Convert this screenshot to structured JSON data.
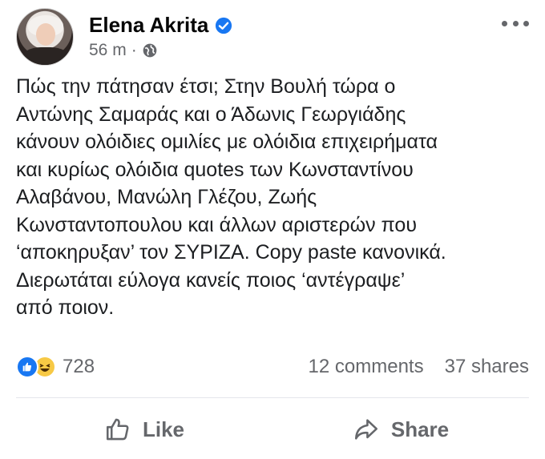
{
  "post": {
    "author": "Elena Akrita",
    "time": "56 m",
    "separator": "·",
    "privacy_icon": "globe-icon",
    "verified_icon": "verified-badge-icon",
    "more_icon": "more-options-icon",
    "text_lines": [
      "Πώς την πάτησαν έτσι; Στην Βουλή τώρα ο",
      "Αντώνης Σαμαράς και ο Άδωνις Γεωργιάδης",
      "κάνουν ολόιδιες ομιλίες με ολόιδια επιχειρήματα",
      "και κυρίως ολόιδια quotes των Κωνσταντίνου",
      "Αλαβάνου, Μανώλη Γλέζου, Ζωής",
      "Κωνσταντοπουλου και άλλων αριστερών που",
      "‘αποκηρυξαν’ τον ΣΥΡΙΖΑ. Copy paste κανονικά.",
      "Διερωτάται εύλογα κανείς ποιος ‘αντέγραψε’",
      "από ποιον."
    ]
  },
  "stats": {
    "reactions_count": "728",
    "reaction_icons": [
      "like-reaction-icon",
      "haha-reaction-icon"
    ],
    "comments": "12 comments",
    "shares": "37 shares"
  },
  "actions": {
    "like_label": "Like",
    "share_label": "Share"
  },
  "colors": {
    "accent": "#1877f2",
    "secondary_text": "#65676b",
    "haha": "#f7c945"
  }
}
